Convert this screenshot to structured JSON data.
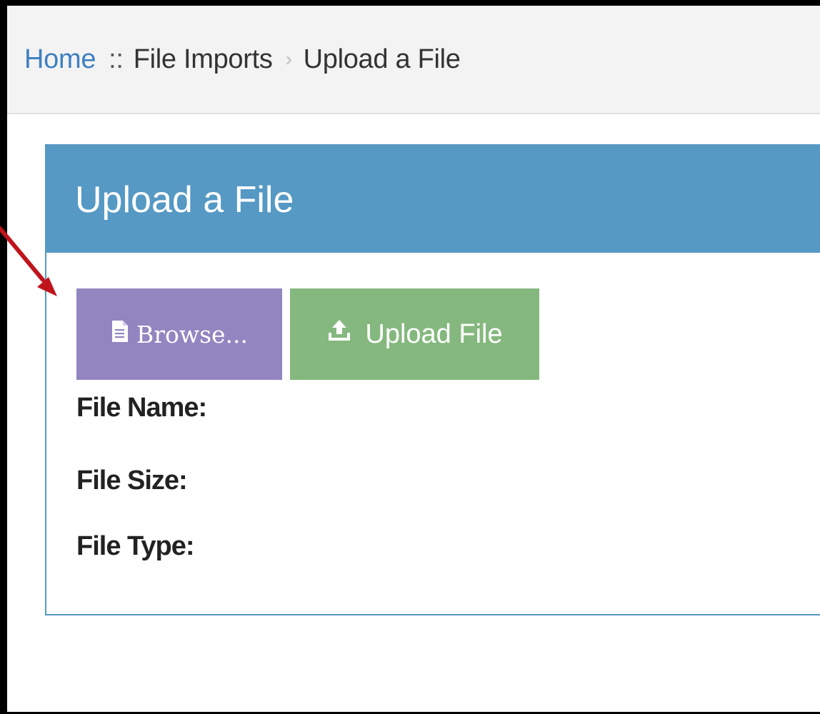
{
  "breadcrumb": {
    "home": "Home",
    "separator": "::",
    "section": "File Imports",
    "arrow": "›",
    "current": "Upload a File"
  },
  "panel": {
    "title": "Upload a File"
  },
  "buttons": {
    "browse_label": "Browse...",
    "browse_icon": "document-icon",
    "upload_label": "Upload File",
    "upload_icon": "upload-icon"
  },
  "file_info": {
    "name_label": "File Name:",
    "size_label": "File Size:",
    "type_label": "File Type:"
  },
  "colors": {
    "header_blue": "#5599c4",
    "browse_purple": "#9285c0",
    "upload_green": "#85b87e",
    "link_blue": "#3f7fc1",
    "annotation_red": "#c0141c"
  }
}
